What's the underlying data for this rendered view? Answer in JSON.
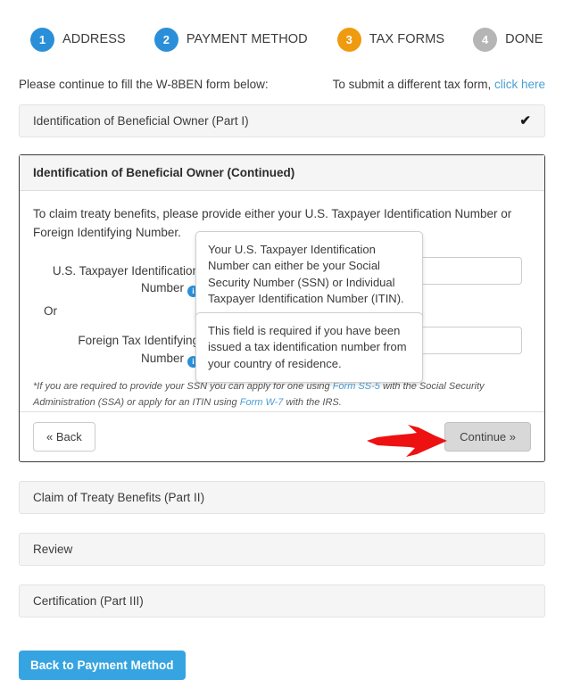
{
  "wizard": {
    "steps": [
      {
        "number": "1",
        "label": "ADDRESS",
        "color": "#2a8fd8",
        "state": "complete"
      },
      {
        "number": "2",
        "label": "PAYMENT METHOD",
        "color": "#2a8fd8",
        "state": "complete"
      },
      {
        "number": "3",
        "label": "TAX FORMS",
        "color": "#ef9b0f",
        "state": "active"
      },
      {
        "number": "4",
        "label": "DONE",
        "color": "#b5b5b5",
        "state": "inactive"
      }
    ]
  },
  "intro": {
    "left_text": "Please continue to fill the W-8BEN form below:",
    "right_text": "To submit a different tax form,",
    "right_link": "click here"
  },
  "panels": {
    "part1": {
      "title": "Identification of Beneficial Owner (Part I)",
      "check": "✔"
    },
    "part2": {
      "title": "Claim of Treaty Benefits (Part II)"
    },
    "review": {
      "title": "Review"
    },
    "part3": {
      "title": "Certification (Part III)"
    }
  },
  "open_panel": {
    "title": "Identification of Beneficial Owner (Continued)",
    "lead": "To claim treaty benefits, please provide either your U.S. Taxpayer Identification Number or Foreign Identifying Number.",
    "fields": {
      "ssn": {
        "label": "U.S. Taxpayer Identification Number",
        "info_icon": "info-icon",
        "value": "",
        "placeholder": ""
      },
      "or_text": "Or",
      "ftin": {
        "label": "Foreign Tax Identifying Number",
        "info_icon": "info-icon",
        "value": "",
        "placeholder": ""
      }
    },
    "footnote": {
      "part1": "*If you are required to provide your SSN you can apply for one using ",
      "link1": "Form SS-5",
      "part2": " with the Social Security Administration (SSA) or apply for an ITIN using ",
      "link2": "Form W-7",
      "part3": " with the IRS."
    },
    "buttons": {
      "back": "« Back",
      "continue": "Continue »"
    }
  },
  "tooltips": {
    "ssn": "Your U.S. Taxpayer Identification Number can either be your Social Security Number (SSN) or Individual Taxpayer Identification Number (ITIN).",
    "ftin": "This field is required if you have been issued a tax identification number from your country of residence."
  },
  "annotation": {
    "arrow_color": "#ee1111",
    "points_to": "Continue »"
  },
  "footer": {
    "back_to_payment": "Back to Payment Method"
  }
}
